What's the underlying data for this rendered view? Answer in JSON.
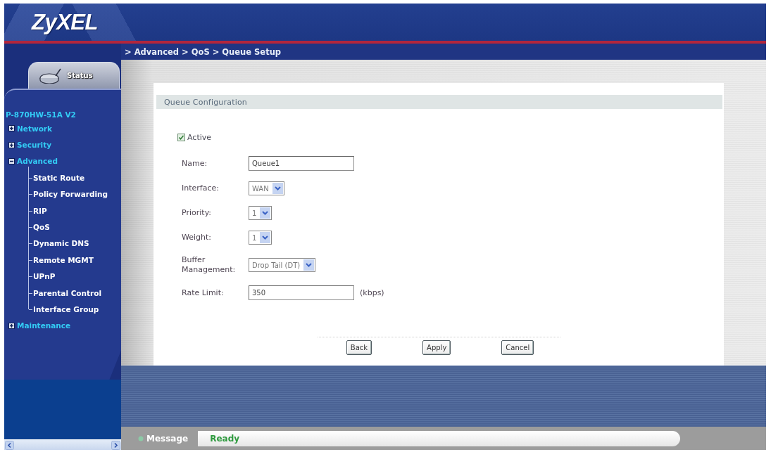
{
  "header": {
    "logo": "ZyXEL"
  },
  "breadcrumb": "> Advanced > QoS > Queue Setup",
  "sidebar": {
    "status_tab": "Status",
    "device": "P-870HW-51A V2",
    "items": [
      {
        "label": "Network",
        "expanded": false
      },
      {
        "label": "Security",
        "expanded": false
      },
      {
        "label": "Advanced",
        "expanded": true,
        "children": [
          {
            "label": "Static Route"
          },
          {
            "label": "Policy Forwarding"
          },
          {
            "label": "RIP"
          },
          {
            "label": "QoS"
          },
          {
            "label": "Dynamic DNS"
          },
          {
            "label": "Remote MGMT"
          },
          {
            "label": "UPnP"
          },
          {
            "label": "Parental Control"
          },
          {
            "label": "Interface Group"
          }
        ]
      },
      {
        "label": "Maintenance",
        "expanded": false
      }
    ]
  },
  "panel": {
    "title": "Queue Configuration",
    "active": {
      "label": "Active",
      "checked": true
    },
    "fields": [
      {
        "kind": "text",
        "label": "Name:",
        "value": "Queue1"
      },
      {
        "kind": "select",
        "label": "Interface:",
        "value": "WAN"
      },
      {
        "kind": "select",
        "label": "Priority:",
        "value": "1"
      },
      {
        "kind": "select",
        "label": "Weight:",
        "value": "1"
      },
      {
        "kind": "select",
        "label": "Buffer Management:",
        "value": "Drop Tail (DT)"
      },
      {
        "kind": "text",
        "label": "Rate Limit:",
        "value": "350",
        "unit": "(kbps)"
      }
    ],
    "buttons": [
      "Back",
      "Apply",
      "Cancel"
    ]
  },
  "status_bar": {
    "label": "Message",
    "message": "Ready"
  }
}
